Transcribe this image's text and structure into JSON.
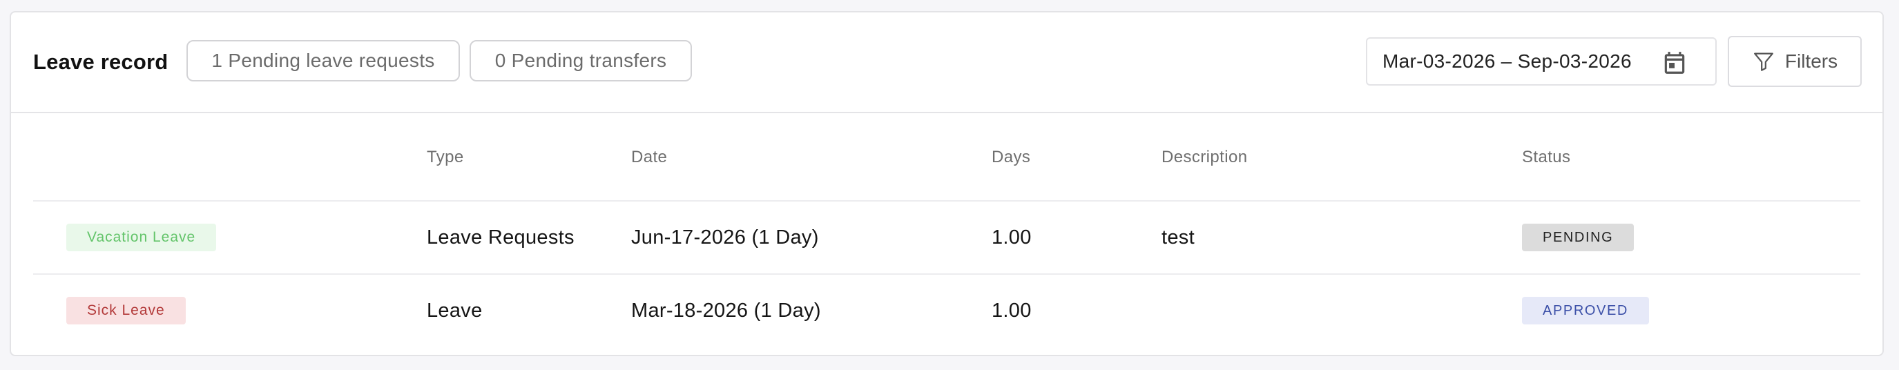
{
  "header": {
    "title": "Leave record",
    "pending_requests": "1 Pending leave requests",
    "pending_transfers": "0 Pending transfers",
    "date_range": "Mar-03-2026 – Sep-03-2026",
    "filters_label": "Filters"
  },
  "table": {
    "columns": {
      "type": "Type",
      "date": "Date",
      "days": "Days",
      "description": "Description",
      "status": "Status"
    },
    "rows": [
      {
        "tag": "Vacation Leave",
        "type": "Leave Requests",
        "date": "Jun-17-2026 (1 Day)",
        "days": "1.00",
        "description": "test",
        "status": "PENDING"
      },
      {
        "tag": "Sick Leave",
        "type": "Leave",
        "date": "Mar-18-2026 (1 Day)",
        "days": "1.00",
        "description": "",
        "status": "APPROVED"
      }
    ]
  },
  "colors": {
    "vacation_tag_bg": "#e9f8ea",
    "vacation_tag_text": "#63c46a",
    "sick_tag_bg": "#f9e1e2",
    "sick_tag_text": "#b33a3a",
    "pending_bg": "#dcdcdc",
    "approved_bg": "#e6e9f8",
    "approved_text": "#3c50a8"
  },
  "icons": {
    "date_picker": "calendar-icon",
    "filters": "filter-funnel-icon"
  }
}
